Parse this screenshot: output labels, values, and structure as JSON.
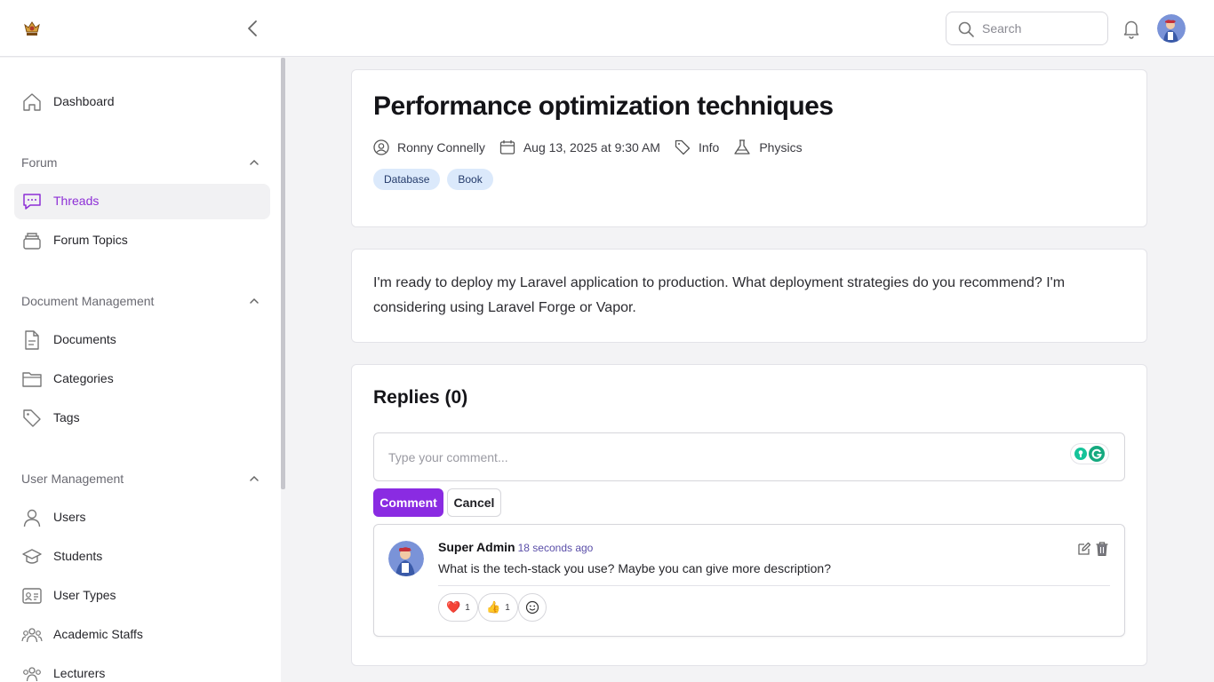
{
  "header": {
    "search_placeholder": "Search"
  },
  "sidebar": {
    "dashboard": "Dashboard",
    "groups": {
      "forum": "Forum",
      "document_management": "Document Management",
      "user_management": "User Management"
    },
    "items": {
      "threads": "Threads",
      "forum_topics": "Forum Topics",
      "documents": "Documents",
      "categories": "Categories",
      "tags": "Tags",
      "users": "Users",
      "students": "Students",
      "user_types": "User Types",
      "academic_staffs": "Academic Staffs",
      "lecturers": "Lecturers"
    },
    "active_item": "Threads"
  },
  "thread": {
    "title": "Performance optimization techniques",
    "author": "Ronny Connelly",
    "date": "Aug 13, 2025 at 9:30 AM",
    "type": "Info",
    "subject": "Physics",
    "tags": [
      "Database",
      "Book"
    ],
    "body": "I'm ready to deploy my Laravel application to production. What deployment strategies do you recommend? I'm considering using Laravel Forge or Vapor."
  },
  "replies": {
    "heading": "Replies (0)",
    "comment_placeholder": "Type your comment...",
    "comment_button": "Comment",
    "cancel_button": "Cancel",
    "items": [
      {
        "author": "Super Admin",
        "time": "18 seconds ago",
        "text": "What is the tech-stack you use? Maybe you can give more description?",
        "reactions": [
          {
            "emoji": "❤️",
            "count": "1"
          },
          {
            "emoji": "👍",
            "count": "1"
          }
        ]
      }
    ]
  },
  "colors": {
    "accent": "#8a2be2",
    "active_text": "#8d2fd6",
    "chip_bg": "#dbe9fb"
  }
}
